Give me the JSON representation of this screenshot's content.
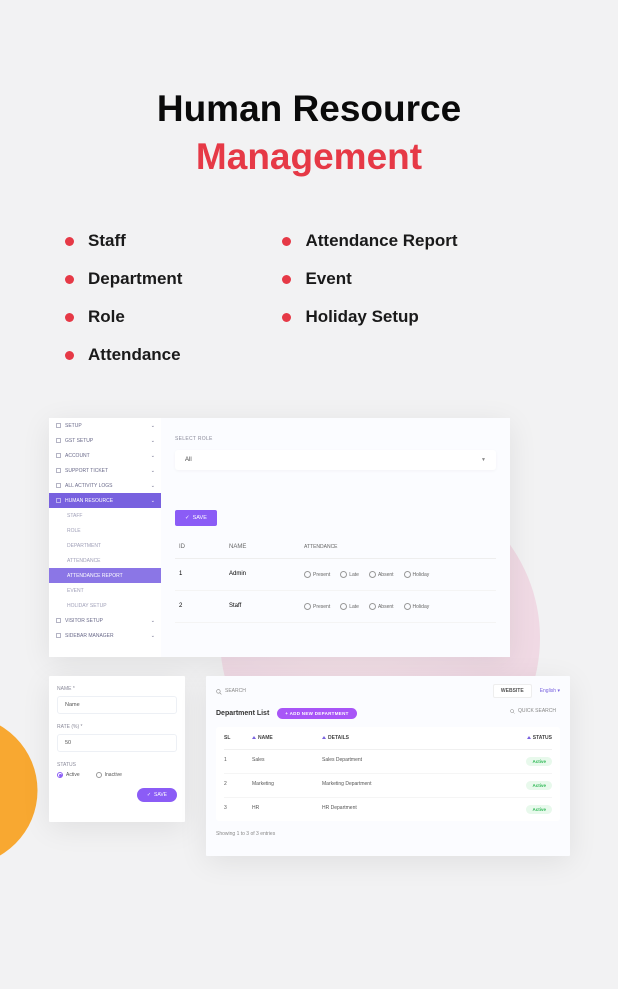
{
  "heading": {
    "line1": "Human Resource",
    "line2": "Management"
  },
  "features": {
    "col1": [
      "Staff",
      "Department",
      "Role",
      "Attendance"
    ],
    "col2": [
      "Attendance Report",
      "Event",
      "Holiday Setup"
    ]
  },
  "panel1": {
    "sidebar": [
      {
        "label": "SETUP",
        "type": "main"
      },
      {
        "label": "GST SETUP",
        "type": "main"
      },
      {
        "label": "ACCOUNT",
        "type": "main"
      },
      {
        "label": "SUPPORT TICKET",
        "type": "main"
      },
      {
        "label": "ALL ACTIVITY LOGS",
        "type": "main"
      },
      {
        "label": "HUMAN RESOURCE",
        "type": "main",
        "active": true
      },
      {
        "label": "STAFF",
        "type": "sub"
      },
      {
        "label": "ROLE",
        "type": "sub"
      },
      {
        "label": "DEPARTMENT",
        "type": "sub"
      },
      {
        "label": "ATTENDANCE",
        "type": "sub"
      },
      {
        "label": "ATTENDANCE REPORT",
        "type": "sub",
        "subac": true
      },
      {
        "label": "EVENT",
        "type": "sub"
      },
      {
        "label": "HOLIDAY SETUP",
        "type": "sub"
      },
      {
        "label": "VISITOR SETUP",
        "type": "main"
      },
      {
        "label": "SIDEBAR MANAGER",
        "type": "main"
      }
    ],
    "select_label": "SELECT ROLE",
    "select_value": "All",
    "save": "SAVE",
    "table": {
      "cols": {
        "id": "ID",
        "name": "NAME",
        "att": "ATTENDANCE"
      },
      "radios": [
        "Present",
        "Late",
        "Absent",
        "Holiday"
      ],
      "rows": [
        {
          "id": "1",
          "name": "Admin"
        },
        {
          "id": "2",
          "name": "Staff"
        }
      ]
    }
  },
  "panel2": {
    "name_label": "NAME *",
    "name_ph": "Name",
    "rate_label": "RATE (%) *",
    "rate_val": "50",
    "status_label": "STATUS",
    "active": "Active",
    "inactive": "Inactive",
    "save": "SAVE"
  },
  "panel3": {
    "search": "SEARCH",
    "website": "WEBSITE",
    "lang": "English",
    "title": "Department List",
    "add": "+ ADD NEW DEPARTMENT",
    "quick": "QUICK SEARCH",
    "cols": {
      "sl": "SL",
      "name": "NAME",
      "details": "DETAILS",
      "status": "STATUS"
    },
    "rows": [
      {
        "sl": "1",
        "name": "Sales",
        "details": "Sales Department",
        "status": "Active"
      },
      {
        "sl": "2",
        "name": "Marketing",
        "details": "Marketing Department",
        "status": "Active"
      },
      {
        "sl": "3",
        "name": "HR",
        "details": "HR Department",
        "status": "Active"
      }
    ],
    "footer": "Showing 1 to 3 of 3 entries"
  }
}
